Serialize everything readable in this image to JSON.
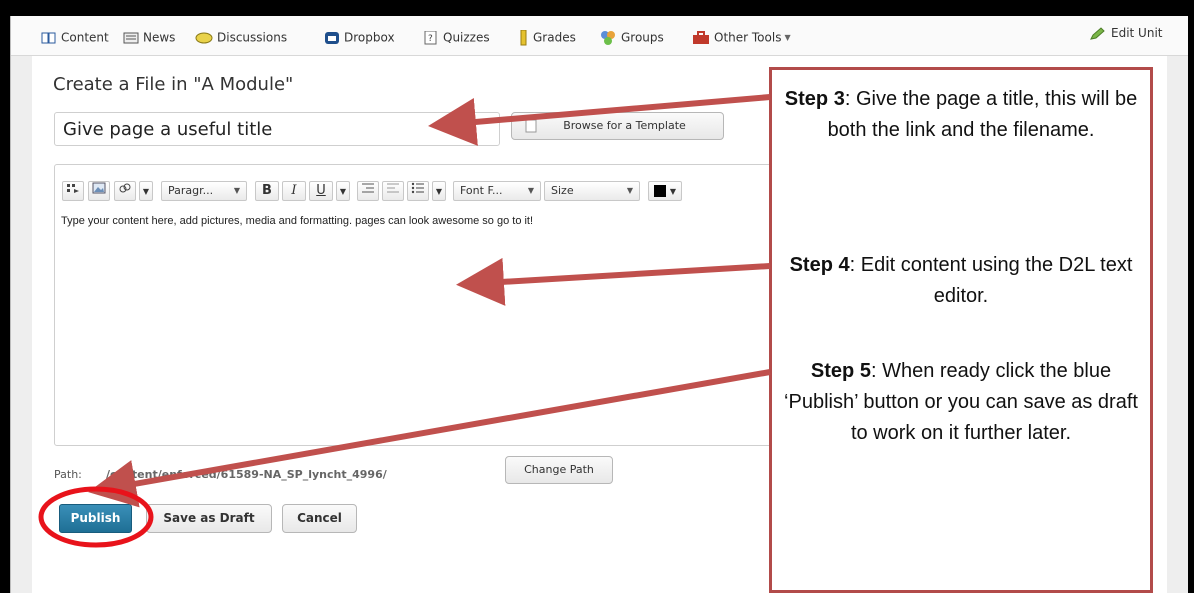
{
  "colors": {
    "arrow": "#c0504d",
    "callout_border": "#b24b4a",
    "highlight_circle": "#e8131b",
    "publish": "#2a7fa8"
  },
  "navbar": {
    "items": [
      {
        "label": "Content",
        "icon": "book-icon"
      },
      {
        "label": "News",
        "icon": "news-icon"
      },
      {
        "label": "Discussions",
        "icon": "discussions-icon"
      },
      {
        "label": "Dropbox",
        "icon": "dropbox-icon"
      },
      {
        "label": "Quizzes",
        "icon": "quiz-icon"
      },
      {
        "label": "Grades",
        "icon": "grades-icon"
      },
      {
        "label": "Groups",
        "icon": "groups-icon"
      },
      {
        "label": "Other Tools",
        "icon": "toolbox-icon"
      }
    ],
    "edit_unit": "Edit Unit"
  },
  "page_title": "Create a File in \"A Module\"",
  "title_input": {
    "value": "Give page a useful title"
  },
  "browse_template": "Browse for a Template",
  "editor": {
    "paragraph_select": "Paragr...",
    "font_select": "Font F...",
    "size_select": "Size",
    "bold": "B",
    "italic": "I",
    "underline": "U",
    "content": "Type your content here, add pictures, media and formatting. pages can look awesome so go to it!"
  },
  "path": {
    "label": "Path:",
    "value": "/content/enforced/61589-NA_SP_lyncht_4996/"
  },
  "change_path": "Change Path",
  "publish": "Publish",
  "save_draft": "Save as Draft",
  "cancel": "Cancel",
  "callout": {
    "step3": {
      "label": "Step 3",
      "text": ": Give the page a title, this will be both the link and the filename."
    },
    "step4": {
      "label": "Step 4",
      "text": ": Edit content using the D2L text editor."
    },
    "step5": {
      "label": "Step 5",
      "text": ": When ready click the blue ‘Publish’ button or you can save as draft to work on it further later."
    }
  }
}
